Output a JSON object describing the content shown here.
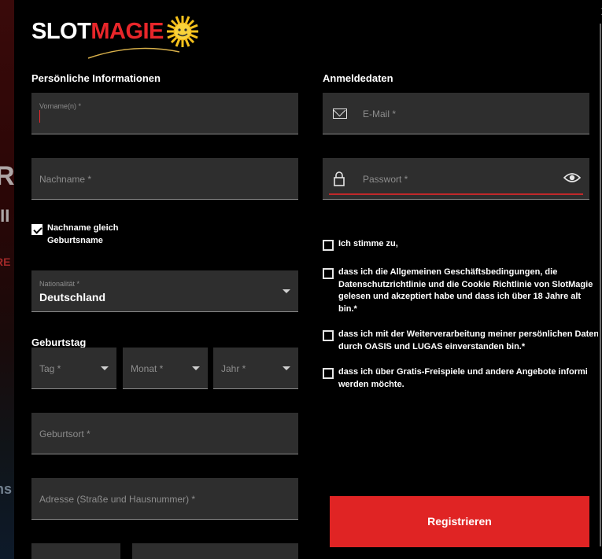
{
  "close_icon": "×",
  "background_fragments": [
    "R",
    "III",
    "RE",
    "ns"
  ],
  "logo": {
    "part1": "SLOT",
    "part2": "MAGIE",
    "brand_color": "#e8262a"
  },
  "personal": {
    "title": "Persönliche Informationen",
    "first_name": {
      "label": "Vorname(n) *",
      "value": ""
    },
    "last_name": {
      "placeholder": "Nachname *"
    },
    "same_birthname": {
      "label_line1": "Nachname gleich",
      "label_line2": "Geburtsname",
      "checked": true
    },
    "nationality": {
      "label": "Nationalität *",
      "value": "Deutschland"
    },
    "birthday_title": "Geburtstag",
    "day": {
      "placeholder": "Tag *"
    },
    "month": {
      "placeholder": "Monat *"
    },
    "year": {
      "placeholder": "Jahr *"
    },
    "birthplace": {
      "placeholder": "Geburtsort *"
    },
    "address": {
      "placeholder": "Adresse (Straße und Hausnummer) *"
    }
  },
  "login": {
    "title": "Anmeldedaten",
    "email": {
      "placeholder": "E-Mail *",
      "icon": "mail-icon"
    },
    "password": {
      "placeholder": "Passwort *",
      "icon": "lock-icon",
      "toggle_icon": "eye-icon"
    }
  },
  "consents": {
    "all": {
      "text": "Ich stimme zu,",
      "checked": false
    },
    "terms": {
      "line1": "dass ich die Allgemeinen Geschäftsbedingungen, die",
      "line2": "Datenschutzrichtlinie und die Cookie Richtlinie von SlotMagie",
      "line3": "gelesen und akzeptiert habe und dass ich über 18 Jahre alt",
      "line4": "bin.*",
      "checked": false
    },
    "data": {
      "line1": "dass ich mit der Weiterverarbeitung meiner persönlichen Daten",
      "line2": "durch OASIS und LUGAS einverstanden bin.*",
      "checked": false
    },
    "marketing": {
      "line1": "dass ich über Gratis-Freispiele und andere Angebote informiert",
      "line2": "werden möchte.",
      "checked": false
    }
  },
  "register_button": {
    "label": "Registrieren",
    "color": "#e02424"
  }
}
